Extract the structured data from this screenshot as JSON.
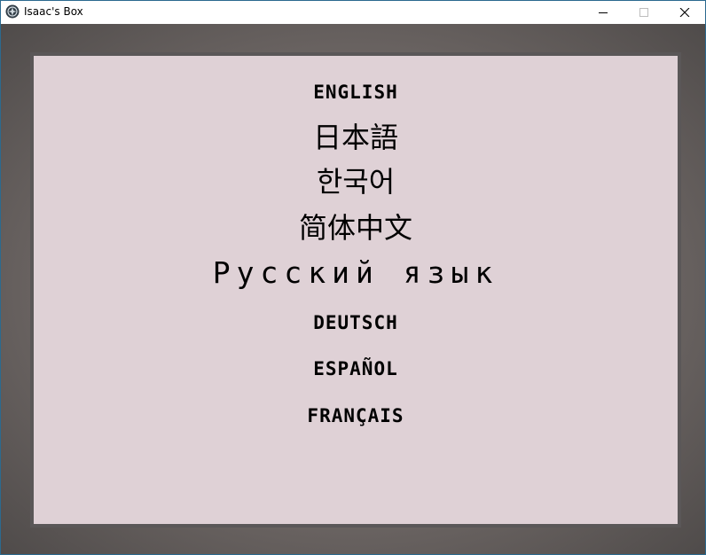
{
  "window": {
    "title": "Isaac's Box",
    "controls": {
      "minimize_icon": "minimize-icon",
      "maximize_icon": "maximize-icon",
      "close_icon": "close-icon"
    }
  },
  "language_menu": {
    "options": [
      {
        "id": "english",
        "label": "ENGLISH"
      },
      {
        "id": "japanese",
        "label": "日本語"
      },
      {
        "id": "korean",
        "label": "한국어"
      },
      {
        "id": "chinese",
        "label": "简体中文"
      },
      {
        "id": "russian",
        "label": "Русский язык"
      },
      {
        "id": "german",
        "label": "DEUTSCH"
      },
      {
        "id": "spanish",
        "label": "ESPAÑOL"
      },
      {
        "id": "french",
        "label": "FRANÇAIS"
      }
    ]
  },
  "colors": {
    "panel_background": "#dfd1d6",
    "panel_border": "#5a5758",
    "backdrop": "#6f6866",
    "text": "#000000"
  }
}
